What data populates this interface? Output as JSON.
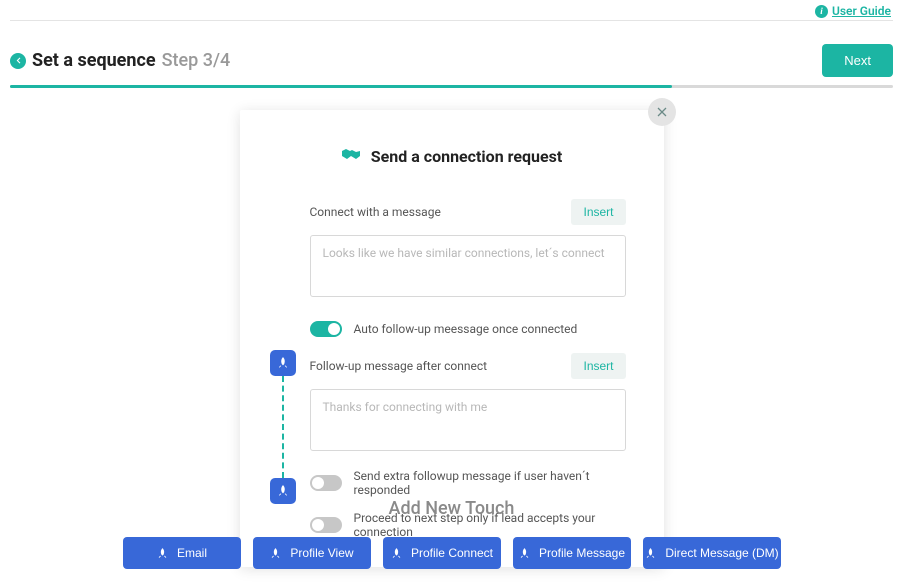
{
  "header": {
    "user_guide": "User Guide",
    "title": "Set a sequence",
    "step": "Step 3/4",
    "next_btn": "Next"
  },
  "progress": {
    "percent": 75
  },
  "modal": {
    "title": "Send a connection request",
    "connect_label": "Connect with a message",
    "connect_insert": "Insert",
    "connect_placeholder": "Looks like we have similar connections, let´s connect",
    "auto_followup_label": "Auto follow-up meessage once connected",
    "auto_followup_on": true,
    "followup_label": "Follow-up message after connect",
    "followup_insert": "Insert",
    "followup_placeholder": "Thanks for connecting with me",
    "extra_followup_label": "Send extra followup message if user haven´t responded",
    "extra_followup_on": false,
    "proceed_label": "Proceed to next step only if lead accepts your connection",
    "proceed_on": false
  },
  "touch": {
    "title": "Add New Touch",
    "buttons": {
      "email": "Email",
      "profile_view": "Profile View",
      "profile_connect": "Profile Connect",
      "profile_message": "Profile Message",
      "dm": "Direct Message (DM)"
    }
  }
}
